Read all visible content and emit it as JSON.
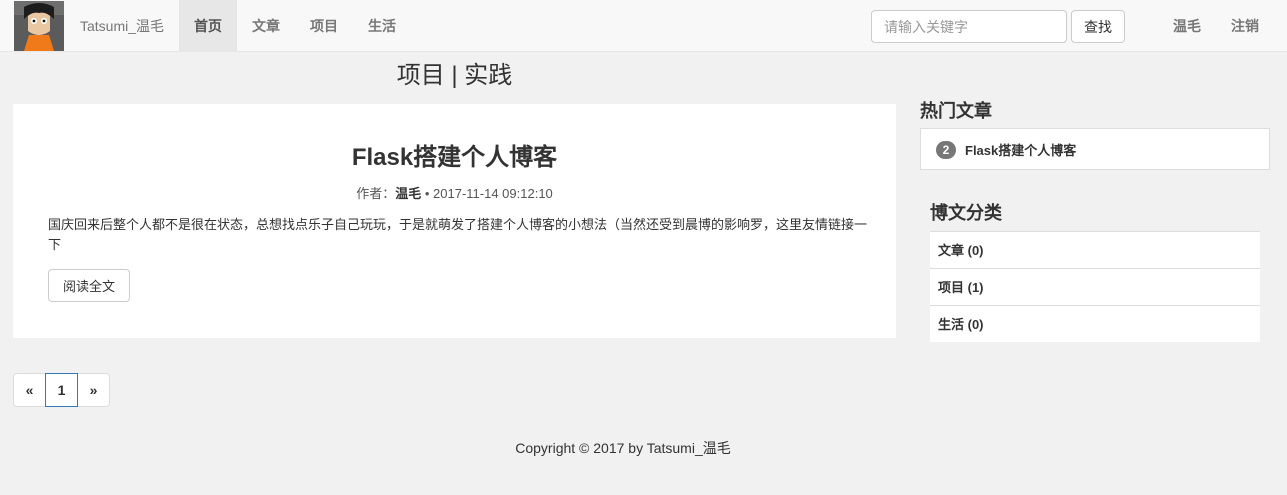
{
  "navbar": {
    "brand": "Tatsumi_温毛",
    "items": [
      {
        "label": "首页"
      },
      {
        "label": "文章"
      },
      {
        "label": "项目"
      },
      {
        "label": "生活"
      }
    ],
    "search": {
      "placeholder": "请输入关键字",
      "button": "查找"
    },
    "user": "温毛",
    "logout": "注销"
  },
  "main": {
    "title": "项目 | 实践",
    "post": {
      "title": "Flask搭建个人博客",
      "author_prefix": "作者：",
      "author": "温毛",
      "separator": " • ",
      "date": "2017-11-14 09:12:10",
      "excerpt": "国庆回来后整个人都不是很在状态，总想找点乐子自己玩玩，于是就萌发了搭建个人博客的小想法（当然还受到晨博的影响罗，这里友情链接一下",
      "read_more": "阅读全文"
    },
    "pagination": {
      "prev": "«",
      "current": "1",
      "next": "»"
    }
  },
  "sidebar": {
    "hot_title": "热门文章",
    "hot_items": [
      {
        "rank": "2",
        "title": "Flask搭建个人博客"
      }
    ],
    "category_title": "博文分类",
    "categories": [
      {
        "label": "文章 (0)"
      },
      {
        "label": "项目 (1)"
      },
      {
        "label": "生活 (0)"
      }
    ]
  },
  "footer": {
    "copyright": "Copyright © 2017 by Tatsumi_温毛"
  }
}
